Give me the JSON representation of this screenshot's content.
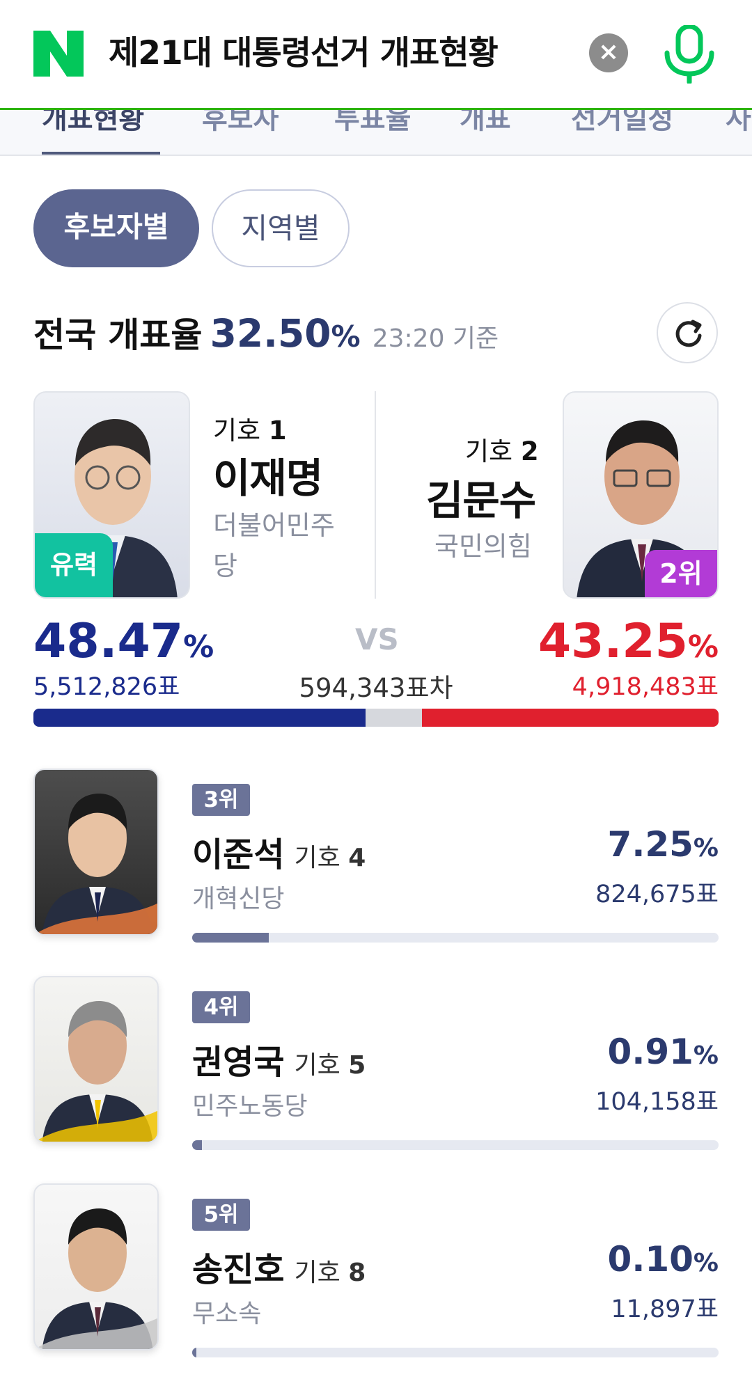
{
  "header": {
    "search_query": "제21대 대통령선거 개표현황",
    "colors": {
      "brand": "#03c75a"
    }
  },
  "tabs": [
    "개표현황",
    "후보자",
    "투표율",
    "개표",
    "선거일정",
    "사"
  ],
  "chips": {
    "active": "후보자별",
    "inactive": "지역별"
  },
  "rate": {
    "label": "전국 개표율",
    "value": "32.50",
    "unit": "%",
    "time": "23:20 기준"
  },
  "main": {
    "candidate1": {
      "number_label": "기호",
      "number": "1",
      "name": "이재명",
      "party": "더불어민주당",
      "badge": "유력",
      "pct": "48.47",
      "unit": "%",
      "votes": "5,512,826표",
      "share": 48.47,
      "color": "#1a2b8c"
    },
    "candidate2": {
      "number_label": "기호",
      "number": "2",
      "name": "김문수",
      "party": "국민의힘",
      "badge": "2위",
      "pct": "43.25",
      "unit": "%",
      "votes": "4,918,483표",
      "share": 43.25,
      "color": "#e0202e"
    },
    "vs": "VS",
    "diff": "594,343표차"
  },
  "others": [
    {
      "rank": "3위",
      "name": "이준석",
      "number_label": "기호",
      "number": "4",
      "party": "개혁신당",
      "pct": "7.25",
      "unit": "%",
      "votes": "824,675표",
      "share": 7.25
    },
    {
      "rank": "4위",
      "name": "권영국",
      "number_label": "기호",
      "number": "5",
      "party": "민주노동당",
      "pct": "0.91",
      "unit": "%",
      "votes": "104,158표",
      "share": 0.91
    },
    {
      "rank": "5위",
      "name": "송진호",
      "number_label": "기호",
      "number": "8",
      "party": "무소속",
      "pct": "0.10",
      "unit": "%",
      "votes": "11,897표",
      "share": 0.1
    }
  ]
}
